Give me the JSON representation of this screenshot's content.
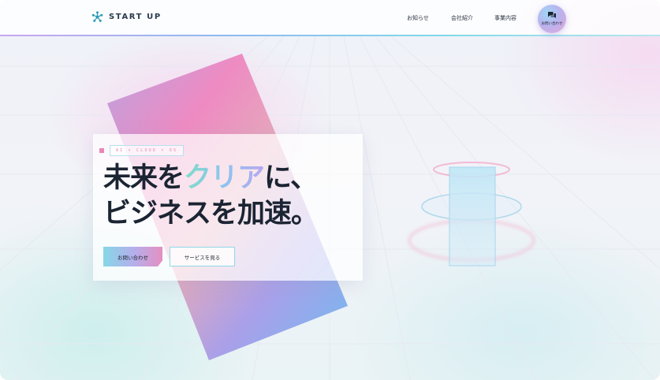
{
  "header": {
    "logo_text": "START UP",
    "nav": [
      {
        "label": "お知らせ"
      },
      {
        "label": "会社紹介"
      },
      {
        "label": "事業内容"
      }
    ],
    "contact_label": "お問い合わせ"
  },
  "hero": {
    "tag": "AI × CLOUD × OS",
    "headline": {
      "line1_before": "未来を",
      "line1_accent": "クリア",
      "line1_after": "に、",
      "line2": "ビジネスを加速。"
    },
    "primary_button": "お問い合わせ",
    "secondary_button": "サービスを見る"
  },
  "colors": {
    "brand_dark": "#1b2432",
    "accent_cyan": "#7fd9e8",
    "accent_violet": "#b3b0ec",
    "accent_pink": "#e58fc2"
  },
  "icons": {
    "logo": "asterisk-logo-icon",
    "contact": "chat-bubbles-icon"
  }
}
